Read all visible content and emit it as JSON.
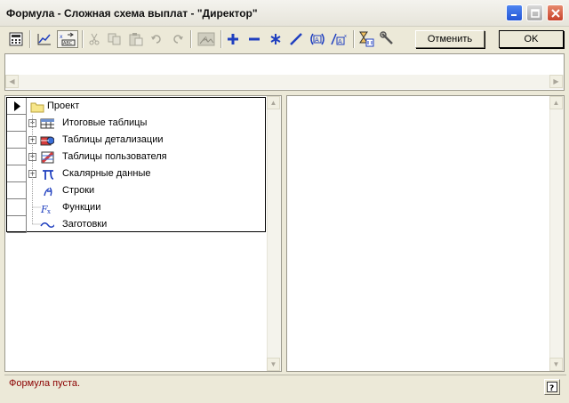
{
  "window": {
    "title": "Формула - Сложная схема выплат - \"Директор\"",
    "controls": [
      "minimize-icon",
      "maximize-icon",
      "close-icon"
    ]
  },
  "toolbar": {
    "icons": [
      "calculator-icon",
      "chart-icon",
      "abs-icon",
      "cut-icon",
      "copy-icon",
      "paste-icon",
      "undo-icon",
      "redo-icon",
      "image-icon",
      "plus-icon",
      "minus-icon",
      "asterisk-icon",
      "slash-icon",
      "parentheses-icon",
      "power-icon",
      "hourglass-icon",
      "wrench-icon"
    ],
    "cancel_label": "Отменить",
    "ok_label": "OK"
  },
  "tree": {
    "root": "Проект",
    "items": [
      {
        "label": "Итоговые таблицы",
        "icon": "table-icon"
      },
      {
        "label": "Таблицы детализации",
        "icon": "detail-table-icon"
      },
      {
        "label": "Таблицы пользователя",
        "icon": "user-table-icon"
      },
      {
        "label": "Скалярные данные",
        "icon": "pi-icon"
      },
      {
        "label": "Строки",
        "icon": "string-icon"
      },
      {
        "label": "Функции",
        "icon": "function-icon"
      },
      {
        "label": "Заготовки",
        "icon": "tilde-icon"
      }
    ]
  },
  "status": {
    "message": "Формула пуста.",
    "message_color": "#8b0000",
    "help_icon": "help-icon"
  },
  "colors": {
    "accent_blue": "#1f3fbf",
    "title_close": "#c7422a"
  }
}
